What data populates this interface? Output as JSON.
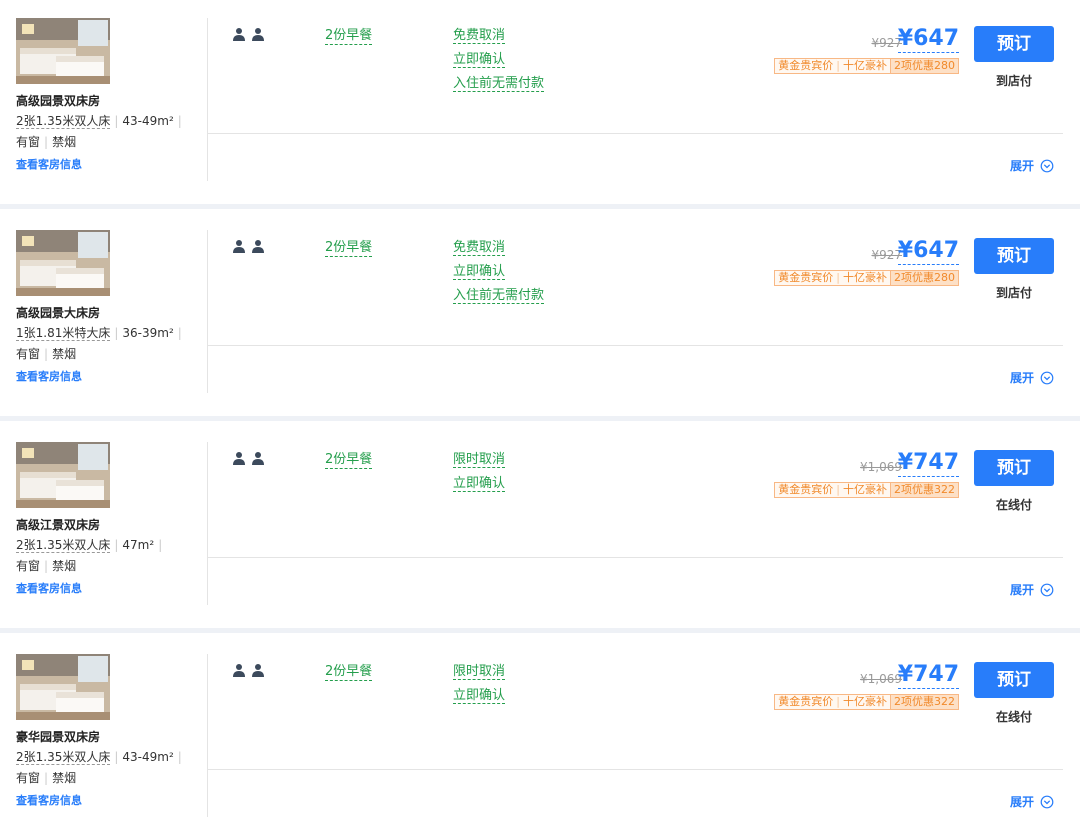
{
  "rooms": [
    {
      "name": "高级园景双床房",
      "bed_type": "2张1.35米双人床",
      "area": "43-49m²",
      "facilities": [
        "有窗",
        "禁烟"
      ],
      "view_info_label": "查看客房信息",
      "guest_icon": "two-person-icon",
      "breakfast": "2份早餐",
      "policies": [
        "免费取消",
        "立即确认",
        "入住前无需付款"
      ],
      "original_price": "¥927",
      "price": "¥647",
      "tag_left": [
        "黄金贵宾价",
        "十亿豪补"
      ],
      "tag_right": "2项优惠280",
      "book_label": "预订",
      "payment": "到店付",
      "expand_label": "展开"
    },
    {
      "name": "高级园景大床房",
      "bed_type": "1张1.81米特大床",
      "area": "36-39m²",
      "facilities": [
        "有窗",
        "禁烟"
      ],
      "view_info_label": "查看客房信息",
      "guest_icon": "two-person-icon",
      "breakfast": "2份早餐",
      "policies": [
        "免费取消",
        "立即确认",
        "入住前无需付款"
      ],
      "original_price": "¥927",
      "price": "¥647",
      "tag_left": [
        "黄金贵宾价",
        "十亿豪补"
      ],
      "tag_right": "2项优惠280",
      "book_label": "预订",
      "payment": "到店付",
      "expand_label": "展开"
    },
    {
      "name": "高级江景双床房",
      "bed_type": "2张1.35米双人床",
      "area": "47m²",
      "facilities": [
        "有窗",
        "禁烟"
      ],
      "view_info_label": "查看客房信息",
      "guest_icon": "two-person-icon",
      "breakfast": "2份早餐",
      "policies": [
        "限时取消",
        "立即确认"
      ],
      "original_price": "¥1,069",
      "price": "¥747",
      "tag_left": [
        "黄金贵宾价",
        "十亿豪补"
      ],
      "tag_right": "2项优惠322",
      "book_label": "预订",
      "payment": "在线付",
      "expand_label": "展开"
    },
    {
      "name": "豪华园景双床房",
      "bed_type": "2张1.35米双人床",
      "area": "43-49m²",
      "facilities": [
        "有窗",
        "禁烟"
      ],
      "view_info_label": "查看客房信息",
      "guest_icon": "two-person-icon",
      "breakfast": "2份早餐",
      "policies": [
        "限时取消",
        "立即确认"
      ],
      "original_price": "¥1,069",
      "price": "¥747",
      "tag_left": [
        "黄金贵宾价",
        "十亿豪补"
      ],
      "tag_right": "2项优惠322",
      "book_label": "预订",
      "payment": "在线付",
      "expand_label": "展开"
    }
  ],
  "colors": {
    "accent": "#287dfa",
    "policy_green": "#249e4c",
    "tag_orange": "#f18a2c"
  }
}
